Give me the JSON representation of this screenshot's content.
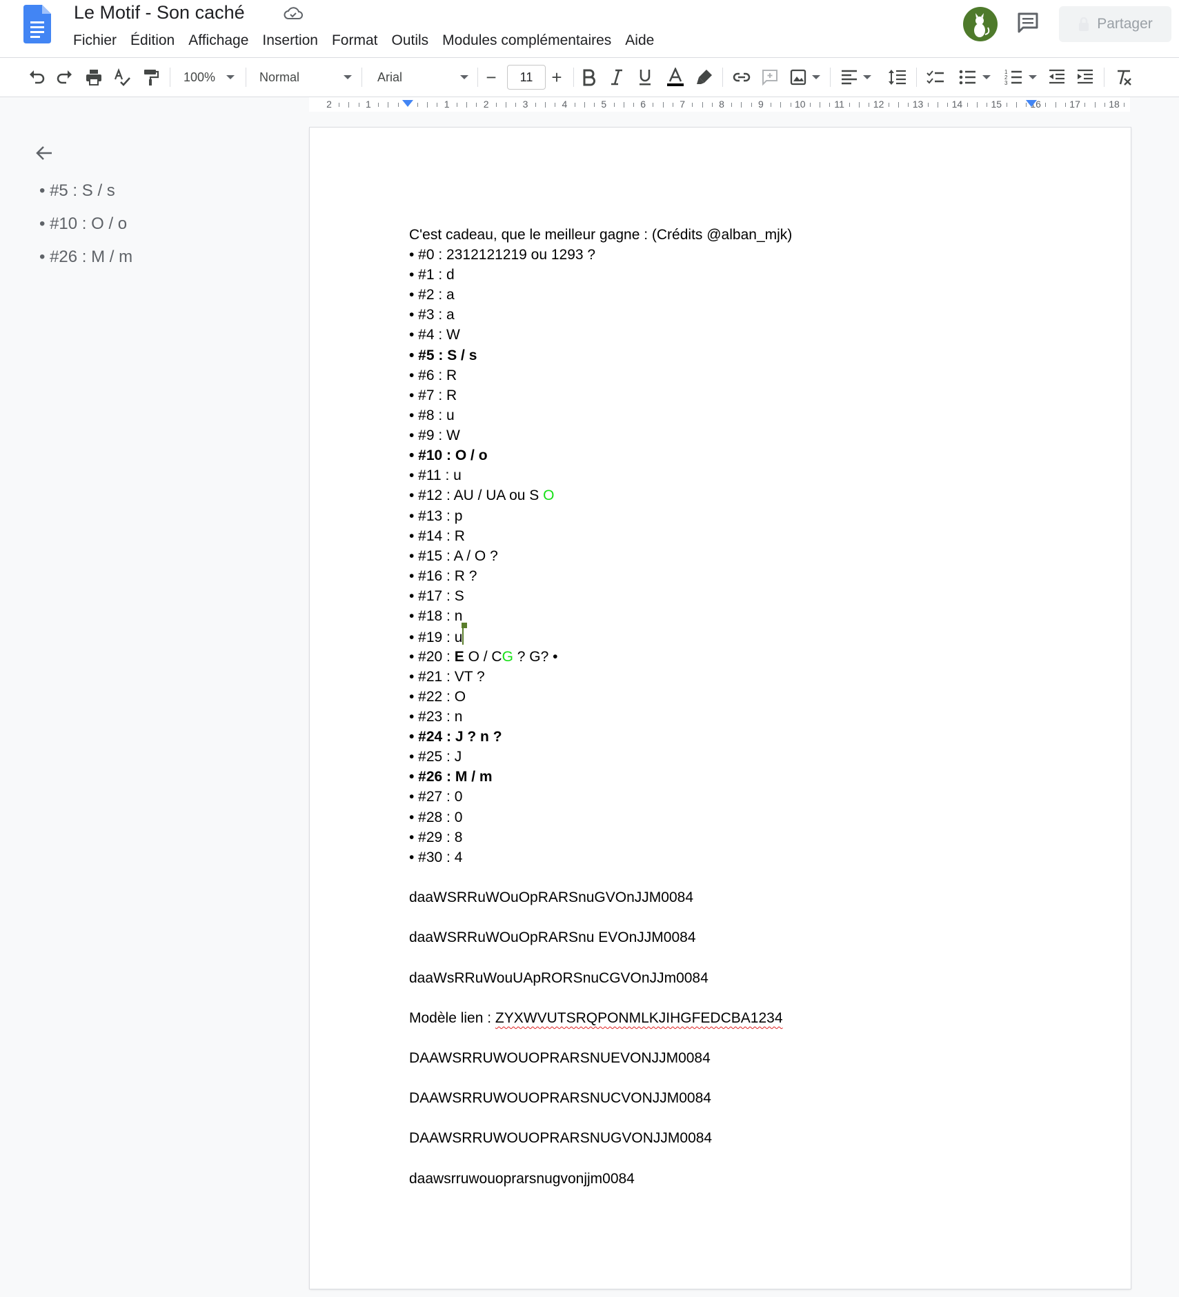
{
  "app": {
    "title": "Le Motif - Son caché",
    "menu": [
      "Fichier",
      "Édition",
      "Affichage",
      "Insertion",
      "Format",
      "Outils",
      "Modules complémentaires",
      "Aide"
    ],
    "share_label": "Partager"
  },
  "toolbar": {
    "zoom": "100%",
    "style": "Normal",
    "font": "Arial",
    "font_size": "11",
    "minus": "−",
    "plus": "+",
    "text_color": "#000000"
  },
  "ruler": {
    "labels": [
      "2",
      "1",
      "",
      "1",
      "2",
      "3",
      "4",
      "5",
      "6",
      "7",
      "8",
      "9",
      "10",
      "11",
      "12",
      "13",
      "14",
      "15",
      "16",
      "17",
      "18"
    ]
  },
  "outline": {
    "items": [
      "• #5 : S / s",
      "• #10 : O / o",
      "• #26 : M / m"
    ]
  },
  "document": {
    "intro": "C'est cadeau, que le meilleur gagne : (Crédits @alban_mjk)",
    "items": {
      "i0": "• #0 : 2312121219 ou 1293 ?",
      "i1": "• #1 : d",
      "i2": "• #2 : a",
      "i3": "• #3 : a",
      "i4": "• #4 : W",
      "i5": "• #5 : S / s",
      "i6": "• #6 : R",
      "i7": "• #7 : R",
      "i8": "• #8 : u",
      "i9": "• #9 : W",
      "i10": "• #10 : O / o",
      "i11": "• #11 : u",
      "i12a": "• #12 : AU / UA ou S ",
      "i12b": "O",
      "i13": "• #13 : p",
      "i14": "• #14 : R",
      "i15": "• #15 : A / O ?",
      "i16": "• #16 : R ?",
      "i17": "• #17 : S",
      "i18": "• #18 : n",
      "i19": "• #19 : u",
      "i20a": "• #20 : ",
      "i20b": "E",
      "i20c": " O / C",
      "i20d": "G",
      "i20e": " ? G? •",
      "i21": "• #21 : VT ?",
      "i22": "• #22 : O",
      "i23": "• #23 : n",
      "i24": "• #24 : J ? n ?",
      "i25": "• #25 : J",
      "i26": "• #26 : M / m",
      "i27": "• #27 : 0",
      "i28": "• #28 : 0",
      "i29": "• #29 : 8",
      "i30": "• #30 : 4"
    },
    "codes": {
      "c1": "daaWSRRuWOuOpRARSnuGVOnJJM0084",
      "c2": "daaWSRRuWOuOpRARSnu EVOnJJM0084",
      "c3": "daaWsRRuWouUApRORSnuCGVOnJJm0084",
      "model_label": "Modèle lien : ",
      "model_value": "ZYXWVUTSRQPONMLKJIHGFEDCBA1234",
      "c4": "DAAWSRRUWOUOPRARSNUEVONJJM0084",
      "c5": "DAAWSRRUWOUOPRARSNUCVONJJM0084",
      "c6": "DAAWSRRUWOUOPRARSNUGVONJJM0084",
      "c7": "daawsrruwouoprarsnugvonjjm0084"
    }
  },
  "colors": {
    "accent": "#4285f4",
    "highlight_green": "#16e016",
    "avatar": "#4e7a2b"
  },
  "icons": [
    "docs-logo",
    "cloud-icon",
    "comment-icon",
    "lock-icon",
    "undo-icon",
    "redo-icon",
    "print-icon",
    "spellcheck-icon",
    "paint-format-icon",
    "bold-icon",
    "italic-icon",
    "underline-icon",
    "text-color-icon",
    "highlight-icon",
    "link-icon",
    "add-comment-icon",
    "image-icon",
    "align-icon",
    "line-spacing-icon",
    "checklist-icon",
    "bullet-list-icon",
    "numbered-list-icon",
    "decrease-indent-icon",
    "increase-indent-icon",
    "clear-format-icon",
    "back-arrow-icon"
  ]
}
